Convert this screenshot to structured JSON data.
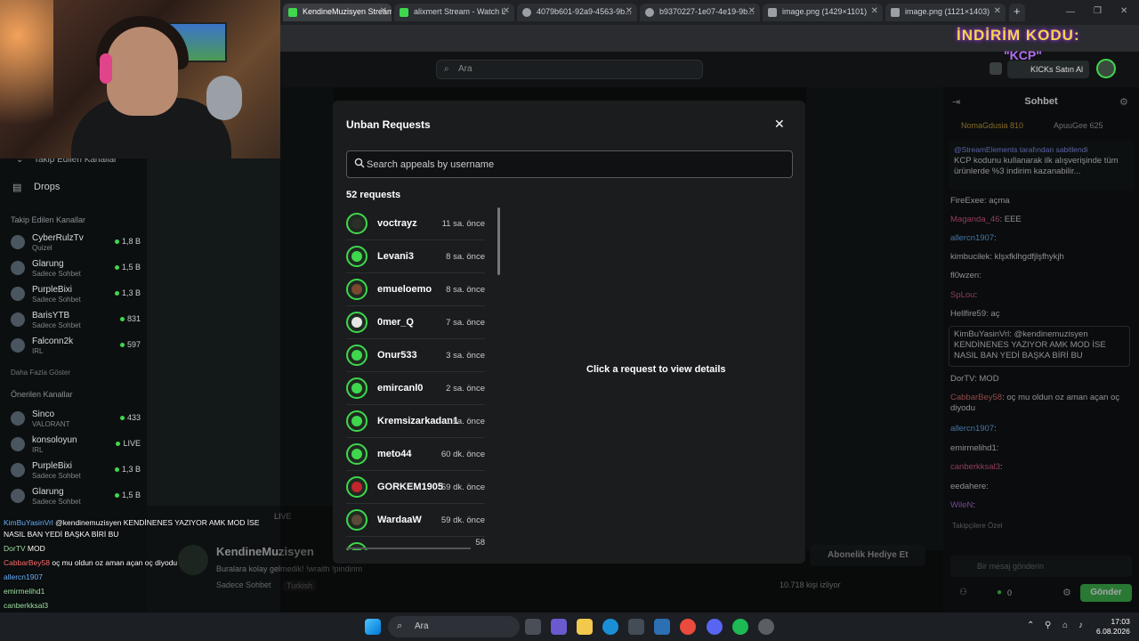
{
  "browser": {
    "tabs": [
      {
        "label": "KendineMuzisyen Stream",
        "color": "#3fd74d"
      },
      {
        "label": "alixmert Stream - Watch L",
        "color": "#3fd74d"
      },
      {
        "label": "4079b601-92a9-4563-9b...",
        "color": "#9aa0a6"
      },
      {
        "label": "b9370227-1e07-4e19-9b...",
        "color": "#9aa0a6"
      },
      {
        "label": "image.png (1429×1101)",
        "color": "#9aa0a6"
      },
      {
        "label": "image.png (1121×1403)",
        "color": "#9aa0a6"
      }
    ],
    "new_tab": "+"
  },
  "site": {
    "search_placeholder": "Ara",
    "kicks_label": "KICKs Satın Al"
  },
  "sidebar": {
    "drops_label": "Drops",
    "followed_partial": "Takip Edilen Kanallar",
    "followed_title": "Takip Edilen Kanallar",
    "followed": [
      {
        "name": "CyberRulzTv",
        "sub": "Quizel",
        "viewers": "1,8 B"
      },
      {
        "name": "Glarung",
        "sub": "Sadece Sohbet",
        "viewers": "1,5 B"
      },
      {
        "name": "PurpleBixi",
        "sub": "Sadece Sohbet",
        "viewers": "1,3 B"
      },
      {
        "name": "BarisYTB",
        "sub": "Sadece Sohbet",
        "viewers": "831"
      },
      {
        "name": "Falconn2k",
        "sub": "IRL",
        "viewers": "597"
      }
    ],
    "show_more": "Daha Fazla Göster",
    "recommended_title": "Önerilen Kanallar",
    "recommended": [
      {
        "name": "Sinco",
        "sub": "VALORANT",
        "viewers": "433"
      },
      {
        "name": "konsoloyun",
        "sub": "IRL",
        "viewers": "LIVE"
      },
      {
        "name": "PurpleBixi",
        "sub": "Sadece Sohbet",
        "viewers": "1,3 B"
      },
      {
        "name": "Glarung",
        "sub": "Sadece Sohbet",
        "viewers": "1,5 B"
      }
    ]
  },
  "modal": {
    "title": "Unban Requests",
    "search_placeholder": "Search appeals by username",
    "count": "52 requests",
    "empty_detail": "Click a request to view details",
    "requests": [
      {
        "username": "voctrayz",
        "time": "11 sa. önce",
        "avatar_color": "#2a2f2a"
      },
      {
        "username": "Levani3",
        "time": "8 sa. önce",
        "avatar_color": "#3fd74d"
      },
      {
        "username": "emueloemo",
        "time": "8 sa. önce",
        "avatar_color": "#7a4a30"
      },
      {
        "username": "0mer_Q",
        "time": "7 sa. önce",
        "avatar_color": "#e6e6e6"
      },
      {
        "username": "Onur533",
        "time": "3 sa. önce",
        "avatar_color": "#3fd74d"
      },
      {
        "username": "emircanl0",
        "time": "2 sa. önce",
        "avatar_color": "#3fd74d"
      },
      {
        "username": "Kremsizarkadan1",
        "time": "1 sa. önce",
        "avatar_color": "#3fd74d"
      },
      {
        "username": "meto44",
        "time": "60 dk. önce",
        "avatar_color": "#3fd74d"
      },
      {
        "username": "GORKEM1905",
        "time": "59 dk. önce",
        "avatar_color": "#c0262d"
      },
      {
        "username": "WardaaW",
        "time": "59 dk. önce",
        "avatar_color": "#5a4a3a"
      },
      {
        "username": "",
        "time": "58",
        "avatar_color": "#3fd74d"
      }
    ]
  },
  "chat": {
    "title": "Sohbet",
    "top_users": [
      "NomaGdusia 810",
      "ApuuGee 625"
    ],
    "pinned_by": "@StreamElements tarafından sabitlendi",
    "pinned_text": "KCP kodunu kullanarak ilk alışverişinde tüm ürünlerde %3 indirim kazanabilir...",
    "messages": [
      {
        "user": "FireExee",
        "text": "açma",
        "color": "#d9dcde"
      },
      {
        "user": "Maganda_46",
        "text": "EEE",
        "color": "#e05d8c"
      },
      {
        "user": "allercn1907",
        "text": "",
        "color": "#6cb4ff"
      },
      {
        "user": "kimbucilek",
        "text": "klşxfklhgdfjlşfhykjh",
        "color": "#d9dcde"
      },
      {
        "user": "fl0wzen",
        "text": "",
        "color": "#d9dcde"
      },
      {
        "user": "SpLou",
        "text": "",
        "color": "#e05d8c"
      },
      {
        "user": "Hellfire59",
        "text": "aç",
        "color": "#d9dcde"
      }
    ],
    "highlight": "KimBuYasinVrl: @kendinemuzisyen KENDİNENES YAZIYOR AMK MOD İSE NASIL BAN YEDİ BAŞKA BİRİ BU",
    "messages2": [
      {
        "user": "DorTV",
        "text": "MOD",
        "color": "#d9dcde"
      },
      {
        "user": "CabbarBey58",
        "text": "oç mu oldun oz aman açan oç diyodu",
        "color": "#e07070"
      },
      {
        "user": "allercn1907",
        "text": "",
        "color": "#6cb4ff"
      },
      {
        "user": "emirmelihd1",
        "text": "",
        "color": "#d9dcde"
      },
      {
        "user": "canberkksal3",
        "text": "",
        "color": "#e05d8c"
      },
      {
        "user": "eedahere",
        "text": "",
        "color": "#d9dcde"
      },
      {
        "user": "WileN",
        "text": "",
        "color": "#b56df0"
      }
    ],
    "followers_only": "Takipçilere Özel",
    "input_placeholder": "Bir mesaj gönderin",
    "send_label": "Gönder",
    "points": "0"
  },
  "overlay_chat": [
    {
      "user": "KimBuYasinVrl",
      "text": " @kendinemuzisyen KENDİNENES YAZIYOR AMK MOD İSE"
    },
    {
      "user": "",
      "text": "NASIL BAN YEDİ BAŞKA BİRİ BU"
    },
    {
      "user": "DorTV",
      "text": " MOD"
    },
    {
      "user": "CabbarBey58",
      "text": " oç mu oldun oz aman açan oç diyodu"
    },
    {
      "user": "allercn1907",
      "text": ""
    },
    {
      "user": "emirmelihd1",
      "text": ""
    },
    {
      "user": "canberkksal3",
      "text": ""
    },
    {
      "user": "eedahere",
      "text": ""
    },
    {
      "user": "WileN",
      "text": ""
    }
  ],
  "channel": {
    "name": "KendineMuzisyen",
    "status": "Buralara kolay gelmedik! !wraith !pindirim",
    "category": "Sadece Sohbet",
    "language": "Turkish",
    "viewers": "10.718 kişi izliyor",
    "gift_label": "Abonelik Hediye Et",
    "live": "LIVE"
  },
  "banner": {
    "line1": "İNDİRİM KODU:",
    "line2": "\"KCP\""
  },
  "taskbar": {
    "search": "Ara",
    "time": "17:03",
    "date": "6.08.2026"
  }
}
